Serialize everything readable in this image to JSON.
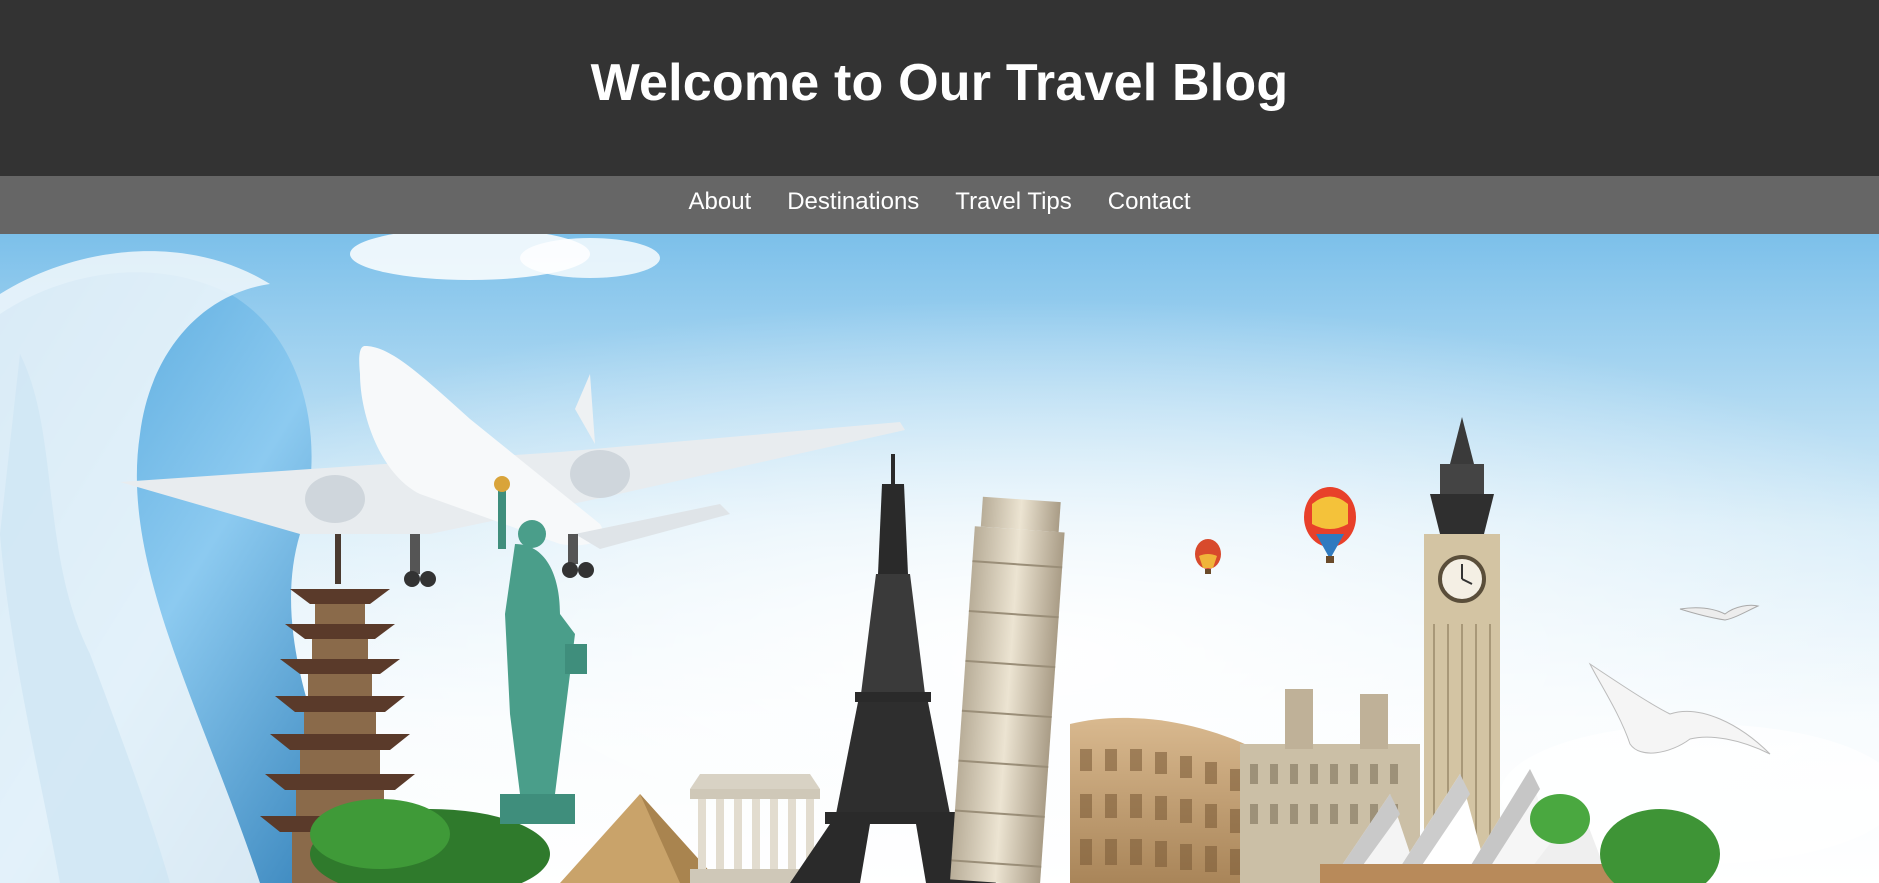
{
  "header": {
    "title": "Welcome to Our Travel Blog"
  },
  "nav": {
    "items": [
      {
        "label": "About"
      },
      {
        "label": "Destinations"
      },
      {
        "label": "Travel Tips"
      },
      {
        "label": "Contact"
      }
    ]
  },
  "hero": {
    "description": "travel-landmarks-collage"
  },
  "colors": {
    "header_bg": "#333333",
    "nav_bg": "#666666",
    "text": "#ffffff"
  }
}
